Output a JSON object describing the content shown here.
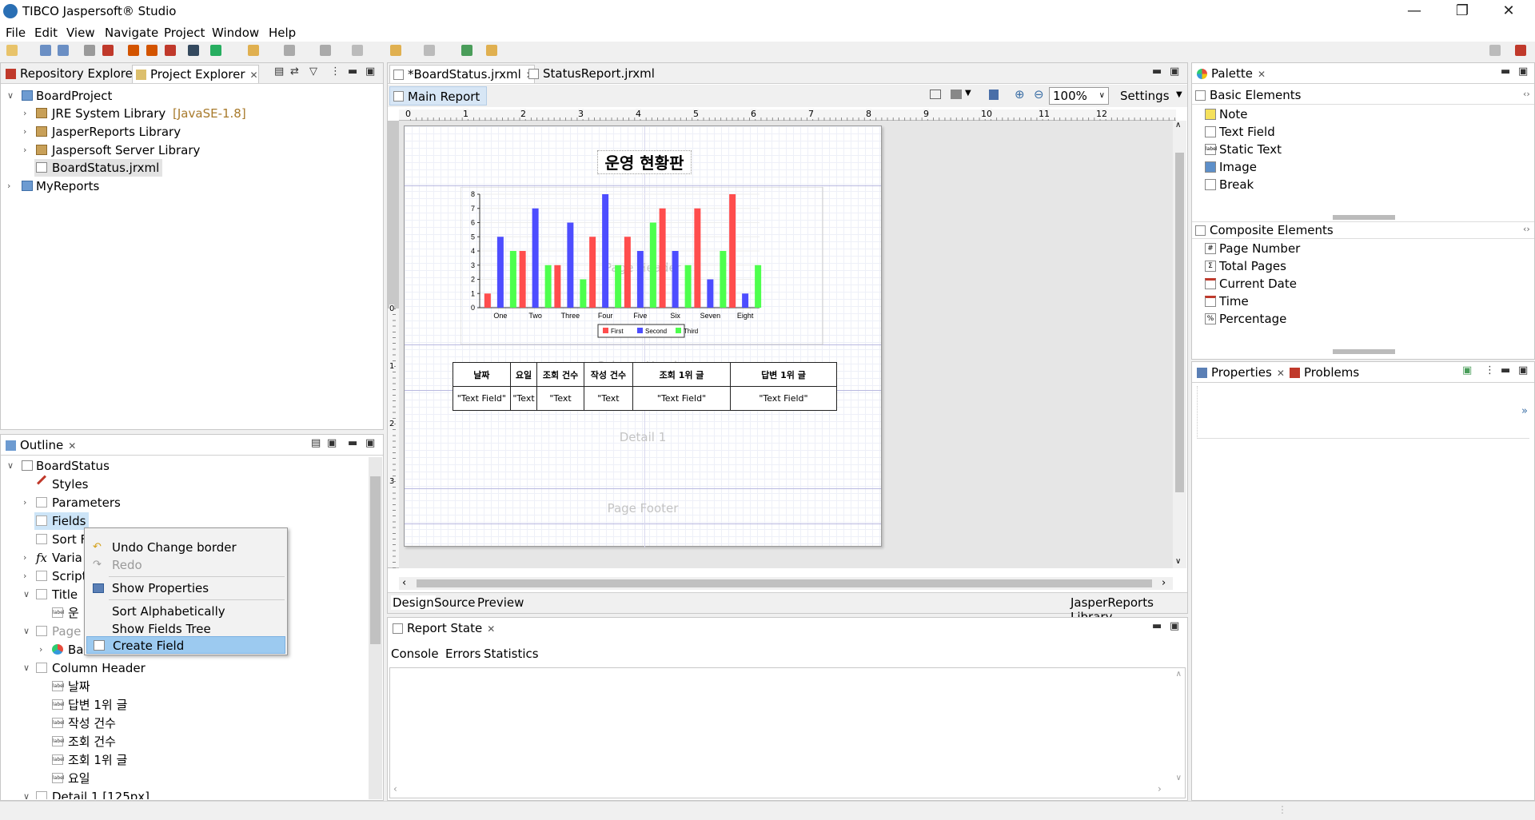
{
  "window": {
    "title": "TIBCO Jaspersoft® Studio"
  },
  "menu": [
    "File",
    "Edit",
    "View",
    "Navigate",
    "Project",
    "Window",
    "Help"
  ],
  "explorer": {
    "tabs": [
      "Repository Explorer",
      "Project Explorer"
    ],
    "tree": [
      {
        "label": "BoardProject"
      },
      {
        "label": "JRE System Library",
        "suffix": "[JavaSE-1.8]"
      },
      {
        "label": "JasperReports Library"
      },
      {
        "label": "Jaspersoft Server Library"
      },
      {
        "label": "BoardStatus.jrxml"
      },
      {
        "label": "MyReports"
      }
    ]
  },
  "outline": {
    "tab": "Outline",
    "items": [
      "BoardStatus",
      "Styles",
      "Parameters",
      "Fields",
      "Sort F",
      "Varia",
      "Script",
      "Title",
      "운",
      "Page",
      "Ba",
      "Column Header",
      "날짜",
      "답변 1위 글",
      "작성 건수",
      "조회 건수",
      "조회 1위 글",
      "요일",
      "Detail 1 [125px]"
    ]
  },
  "context_menu": {
    "items": [
      "Undo Change border",
      "Redo",
      "Show Properties",
      "Sort Alphabetically",
      "Show Fields Tree",
      "Create Field"
    ]
  },
  "editor": {
    "tabs": [
      "*BoardStatus.jrxml",
      "StatusReport.jrxml"
    ],
    "main_report": "Main Report",
    "zoom": "100%",
    "settings": "Settings",
    "ruler_numbers": [
      "0",
      "1",
      "2",
      "3",
      "4",
      "5",
      "6",
      "7",
      "8",
      "9",
      "10",
      "11",
      "12"
    ],
    "vruler_numbers": [
      "0",
      "1",
      "2",
      "3"
    ],
    "report_title": "운영 현황판",
    "bands": {
      "page_header": "Page Header",
      "column_header": "Column Header",
      "detail": "Detail 1",
      "page_footer": "Page Footer"
    },
    "table_headers": [
      "날짜",
      "요일",
      "조회 건수",
      "작성 건수",
      "조회 1위 글",
      "답변 1위 글"
    ],
    "table_cells": [
      "\"Text Field\"",
      "\"Text",
      "\"Text",
      "\"Text",
      "\"Text Field\"",
      "\"Text Field\""
    ],
    "bottom_tabs": [
      "Design",
      "Source",
      "Preview"
    ],
    "library": "JasperReports Library"
  },
  "chart_data": {
    "type": "bar",
    "categories": [
      "One",
      "Two",
      "Three",
      "Four",
      "Five",
      "Six",
      "Seven",
      "Eight"
    ],
    "series": [
      {
        "name": "First",
        "color": "#ff4d4d",
        "values": [
          1,
          4,
          3,
          5,
          5,
          7,
          7,
          8
        ]
      },
      {
        "name": "Second",
        "color": "#4d4dff",
        "values": [
          5,
          7,
          6,
          8,
          4,
          4,
          2,
          1
        ]
      },
      {
        "name": "Third",
        "color": "#4dff4d",
        "values": [
          4,
          3,
          2,
          3,
          6,
          3,
          4,
          3
        ]
      }
    ],
    "ylim": [
      0,
      8
    ],
    "yticks": [
      "0",
      "1",
      "2",
      "3",
      "4",
      "5",
      "6",
      "7",
      "8"
    ],
    "legend": "bottom"
  },
  "palette": {
    "tab": "Palette",
    "basic_title": "Basic Elements",
    "basic": [
      "Note",
      "Text Field",
      "Static Text",
      "Image",
      "Break"
    ],
    "composite_title": "Composite Elements",
    "composite": [
      "Page Number",
      "Total Pages",
      "Current Date",
      "Time",
      "Percentage"
    ]
  },
  "properties": {
    "tabs": [
      "Properties",
      "Problems"
    ]
  },
  "report_state": {
    "tab": "Report State",
    "subtabs": [
      "Console",
      "Errors",
      "Statistics"
    ]
  }
}
